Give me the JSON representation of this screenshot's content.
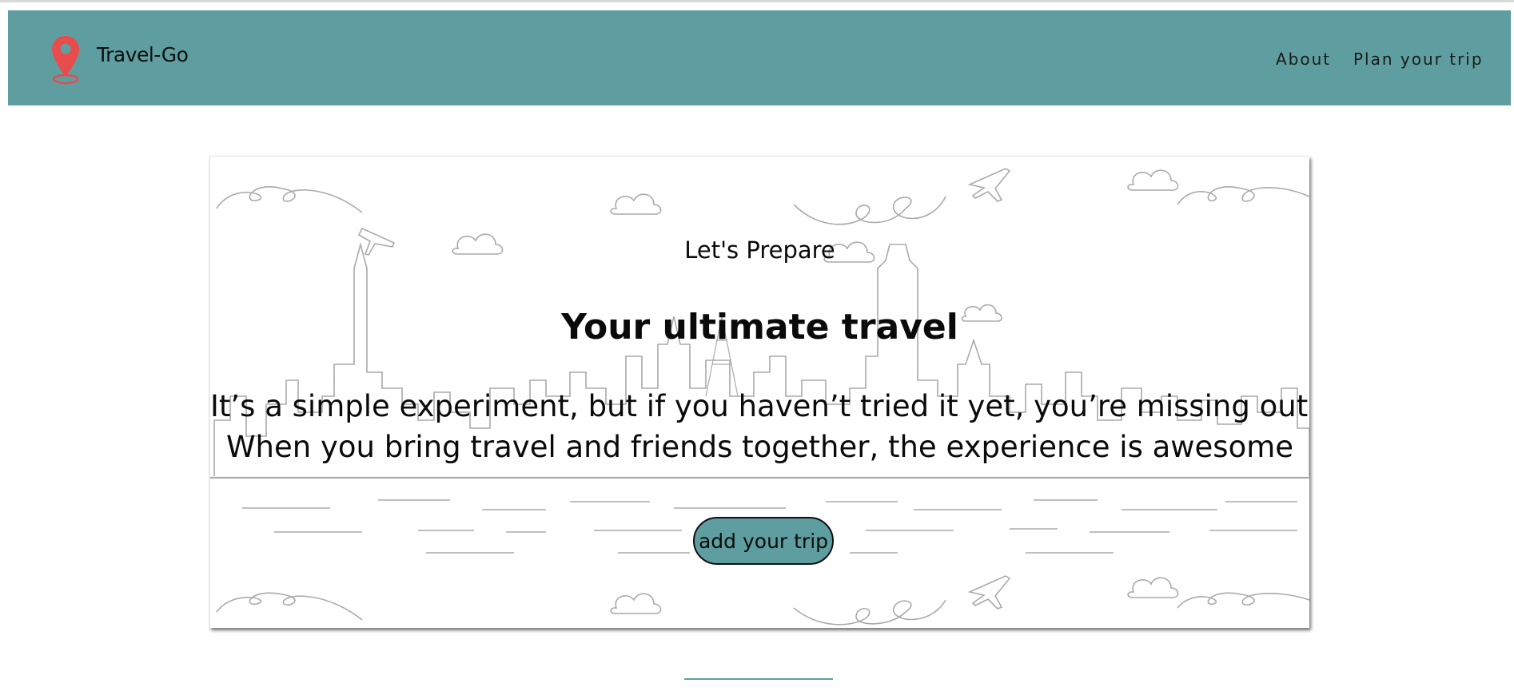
{
  "navbar": {
    "brand": "Travel-Go",
    "logo_icon": "map-pin-icon",
    "links": [
      "About",
      "Plan your trip"
    ],
    "background": "#5f9ea0",
    "logo_color": "#e84c4c"
  },
  "hero": {
    "kicker": "Let's Prepare",
    "headline": "Your ultimate travel",
    "line1": "It’s a simple experiment, but if you haven’t tried it yet, you’re missing out!",
    "line2": "When you bring travel and friends together, the experience is awesome",
    "button_label": "add your trip",
    "illustration": "city-skyline-line-art",
    "button_color": "#5f9ea0"
  }
}
